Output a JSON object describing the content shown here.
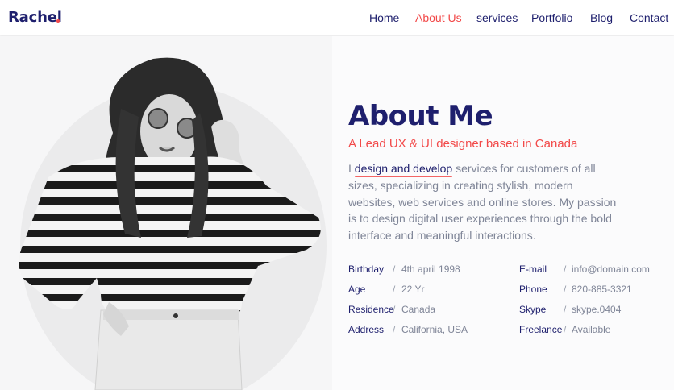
{
  "brand": {
    "name": "Rachel",
    "accent": "#f24a4a",
    "primary": "#1e1f6d"
  },
  "nav": {
    "items": [
      {
        "label": "Home",
        "active": false
      },
      {
        "label": "About Us",
        "active": true
      },
      {
        "label": "services",
        "active": false
      },
      {
        "label": "Portfolio",
        "active": false
      },
      {
        "label": "Blog",
        "active": false
      },
      {
        "label": "Contact",
        "active": false
      }
    ]
  },
  "about": {
    "title": "About Me",
    "subtitle": "A Lead UX & UI designer based in Canada",
    "intro_prefix": "I",
    "intro_highlight": "design and develop",
    "intro_rest": " services for customers of all sizes, specializing in creating stylish, modern websites, web services and online stores. My passion is to design digital user experiences through the bold interface and meaningful interactions."
  },
  "info": {
    "left": [
      {
        "label": "Birthday",
        "value": "4th april 1998"
      },
      {
        "label": "Age",
        "value": "22 Yr"
      },
      {
        "label": "Residence",
        "value": "Canada"
      },
      {
        "label": "Address",
        "value": "California, USA"
      }
    ],
    "right": [
      {
        "label": "E-mail",
        "value": "info@domain.com"
      },
      {
        "label": "Phone",
        "value": "820-885-3321"
      },
      {
        "label": "Skype",
        "value": "skype.0404"
      },
      {
        "label": "Freelance",
        "value": "Available"
      }
    ],
    "separator": "/"
  },
  "photo": {
    "icon": "portrait-photo"
  }
}
